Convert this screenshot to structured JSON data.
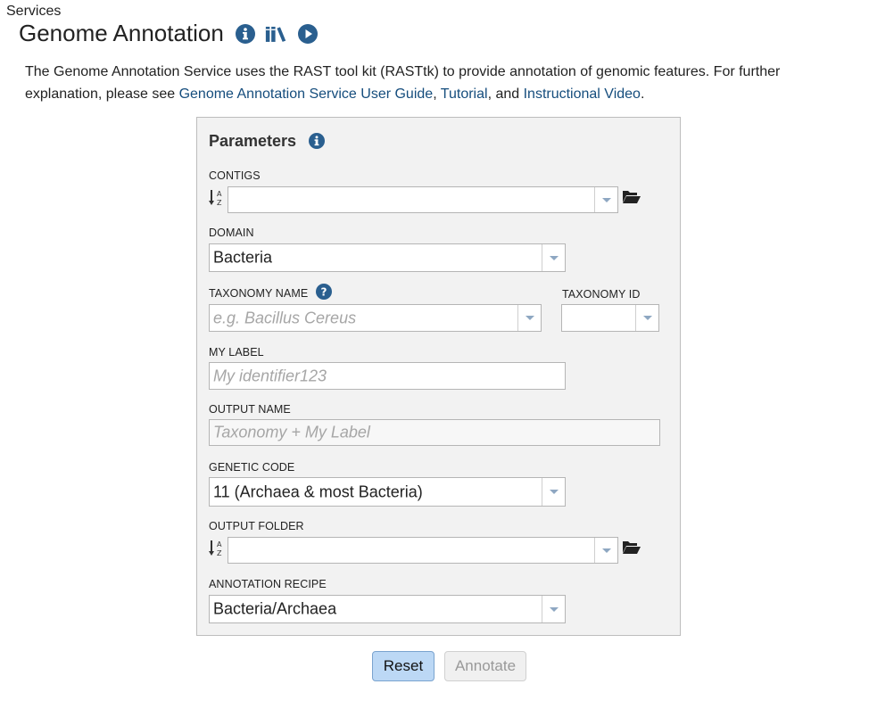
{
  "breadcrumb": "Services",
  "page": {
    "title": "Genome Annotation",
    "icons": [
      "info-icon",
      "book-icon",
      "play-video-icon"
    ]
  },
  "intro": {
    "text_before": "The Genome Annotation Service uses the RAST tool kit (RASTtk) to provide annotation of genomic features. For further explanation, please see ",
    "link_user_guide": "Genome Annotation Service User Guide",
    "sep1": ", ",
    "link_tutorial": "Tutorial",
    "sep2": ", and ",
    "link_video": "Instructional Video",
    "end": "."
  },
  "parameters": {
    "title": "Parameters",
    "contigs": {
      "label": "CONTIGS",
      "value": ""
    },
    "domain": {
      "label": "DOMAIN",
      "value": "Bacteria"
    },
    "taxonomy_name": {
      "label": "TAXONOMY NAME",
      "placeholder": "e.g. Bacillus Cereus"
    },
    "taxonomy_id": {
      "label": "TAXONOMY ID",
      "value": ""
    },
    "my_label": {
      "label": "MY LABEL",
      "placeholder": "My identifier123"
    },
    "output_name": {
      "label": "OUTPUT NAME",
      "placeholder": "Taxonomy + My Label"
    },
    "genetic_code": {
      "label": "GENETIC CODE",
      "value": "11 (Archaea & most Bacteria)"
    },
    "output_folder": {
      "label": "OUTPUT FOLDER",
      "value": ""
    },
    "annotation_recipe": {
      "label": "ANNOTATION RECIPE",
      "value": "Bacteria/Archaea"
    }
  },
  "buttons": {
    "reset": "Reset",
    "annotate": "Annotate"
  },
  "colors": {
    "accent": "#2a5f8f",
    "link": "#154d7d",
    "reset_bg": "#bcd8f5",
    "panel_bg": "#f2f2f2"
  }
}
